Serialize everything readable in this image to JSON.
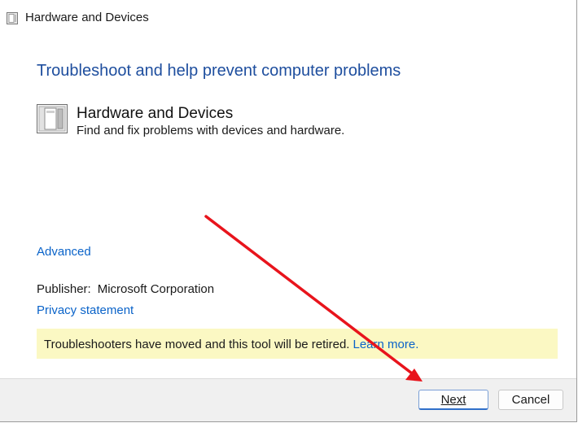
{
  "window": {
    "title": "Hardware and Devices"
  },
  "main": {
    "heading": "Troubleshoot and help prevent computer problems",
    "item": {
      "title": "Hardware and Devices",
      "description": "Find and fix problems with devices and hardware."
    },
    "advanced_link": "Advanced",
    "publisher_label": "Publisher:",
    "publisher_value": "Microsoft Corporation",
    "privacy_link": "Privacy statement",
    "notice": {
      "text": "Troubleshooters have moved and this tool will be retired.",
      "link": "Learn more."
    }
  },
  "footer": {
    "next_label": "Next",
    "cancel_label": "Cancel"
  },
  "colors": {
    "heading": "#1e4e9e",
    "link": "#0a63c9",
    "notice_bg": "#fbf8c3",
    "annotation_arrow": "#e8141c"
  },
  "icons": {
    "title_icon": "hardware-devices-icon",
    "item_icon": "hardware-devices-icon"
  }
}
